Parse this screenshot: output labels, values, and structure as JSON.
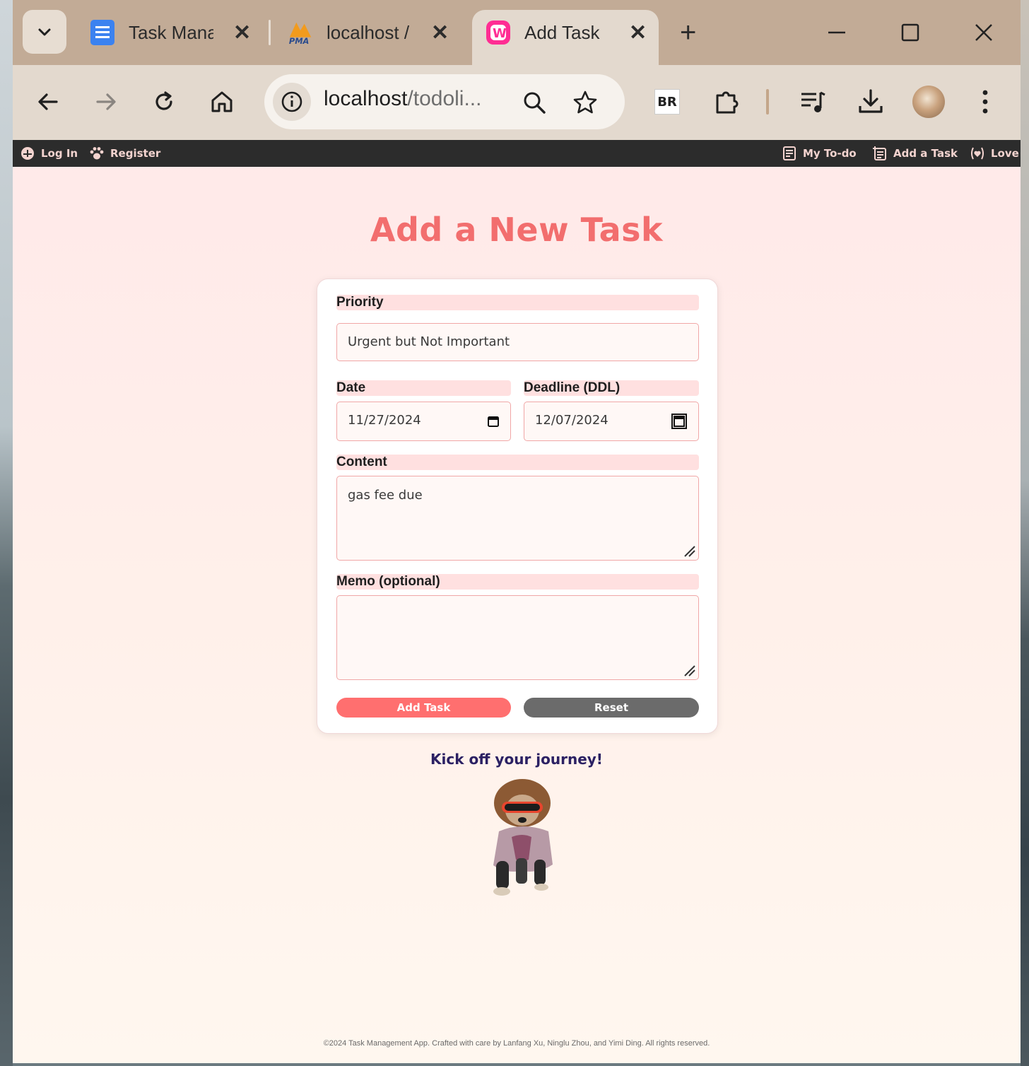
{
  "browser": {
    "tabs": [
      {
        "label": "Task Manag",
        "icon": "docs-icon"
      },
      {
        "label": "localhost /",
        "icon": "phpmyadmin-icon"
      },
      {
        "label": "Add Task",
        "icon": "wampserver-icon"
      }
    ],
    "tab_close": "✕",
    "new_tab": "+",
    "omnibox": {
      "host": "localhost",
      "path": "/todoli..."
    },
    "br_extension_label": "BR"
  },
  "nav": {
    "left": [
      {
        "label": "Log In",
        "icon": "login-icon"
      },
      {
        "label": "Register",
        "icon": "paw-icon"
      }
    ],
    "right": [
      {
        "label": "My To-do",
        "icon": "list-icon"
      },
      {
        "label": "Add a Task",
        "icon": "add-list-icon"
      },
      {
        "label": "Love",
        "icon": "heart-icon"
      }
    ]
  },
  "page": {
    "heading": "Add a New Task",
    "form": {
      "priority_label": "Priority",
      "priority_value": "Urgent but Not Important",
      "date_label": "Date",
      "date_value": "11/27/2024",
      "deadline_label": "Deadline (DDL)",
      "deadline_value": "12/07/2024",
      "content_label": "Content",
      "content_value": "gas fee due",
      "memo_label": "Memo (optional)",
      "memo_value": "",
      "add_button": "Add Task",
      "reset_button": "Reset"
    },
    "tagline": "Kick off your journey!",
    "footer": "©2024 Task Management App. Crafted with care by Lanfang Xu, Ninglu Zhou, and Yimi Ding. All rights reserved."
  },
  "colors": {
    "accent": "#f26e6e",
    "add_button": "#ff6f6f",
    "reset_button": "#6b6b6b",
    "nav_bg": "#2c2c2c",
    "label_bg": "#ffe0e0"
  }
}
